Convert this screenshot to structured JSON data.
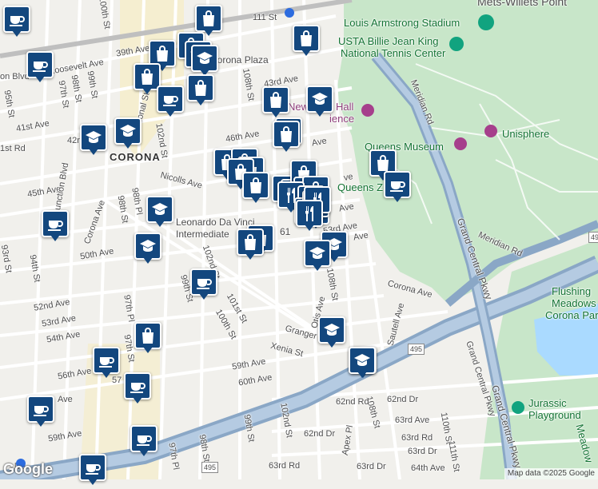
{
  "map": {
    "water_color": "#aadaff",
    "park_color": "#c8e6c9",
    "highway_color": "#8aa7c6",
    "marker_color": "#13477e",
    "attribution": "Map data ©2025 Google",
    "brand": "Google"
  },
  "labels": {
    "mets_willets": "Mets-Willets Point",
    "louis_armstrong": "Louis Armstrong Stadium",
    "usta_1": "USTA Billie Jean King",
    "usta_2": "National Tennis Center",
    "queens_museum": "Queens Museum",
    "unisphere": "Unisphere",
    "queens_zoo": "Queens Z",
    "hall_science_a": "New",
    "hall_science_b": "Hall",
    "hall_science_c": "ience",
    "flushing_1": "Flushing",
    "flushing_2": "Meadows",
    "flushing_3": "Corona Park",
    "jurassic_1": "Jurassic",
    "jurassic_2": "Playground",
    "meadow": "Meadow",
    "corona": "CORONA",
    "corona_plaza": "Corona Plaza",
    "leonardo_1": "Leonardo Da Vinci",
    "leonardo_2": "Intermediate",
    "num_61": "61",
    "st111": "111 St",
    "roosevelt": "Roosevelt Ave",
    "st39": "39th Ave",
    "st100": "100th St",
    "on_blvd": "on Blvd",
    "st97a": "97th St",
    "st98a": "98th St",
    "st99a": "99th St",
    "st95": "95th St",
    "ave41": "41st Ave",
    "ave41b": "1st Rd",
    "ave42": "42n",
    "national_st": "National St",
    "st102a": "102nd St",
    "st108a": "108th St",
    "ave43": "43rd Ave",
    "ave46": "46th Ave",
    "ave45": "45th Ave",
    "nicolls": "Nicolls Ave",
    "junction": "Junction Blvd",
    "corona_ave": "Corona Ave",
    "st98b": "98th St",
    "st98pl": "98th Pl",
    "st94": "94th St",
    "st93": "93rd St",
    "ave50": "50th Ave",
    "st102b": "102nd St",
    "st99b": "99th St",
    "st101": "101st St",
    "st100b": "100th St",
    "st97pl": "97th Pl",
    "ave52": "52nd Ave",
    "ave53": "53rd Ave",
    "ave54": "54th Ave",
    "st97b": "97th St",
    "ave56": "56th Ave",
    "ave57": "57",
    "ave_w": "Ave",
    "ave59": "59th Ave",
    "granger": "Granger St",
    "xenia": "Xenia St",
    "ave59b": "59th Ave",
    "ave60": "60th Ave",
    "otis": "Otis Ave",
    "st108b": "108th St",
    "sautell": "Sautell Ave",
    "corona_ave2": "Corona Ave",
    "ave53b": "53rd Ave",
    "ave_e": "Ave",
    "ave_51": "Ave",
    "ave_49": "Ave",
    "ave_47": "ve",
    "grand_central": "Grand Central Pkwy",
    "grand_central2": "Grand Central Pkwy",
    "grand_central3": "Grand Central Pkwy",
    "meridian_rd": "Meridian Rd",
    "meridian_rd2": "Meridian Rd",
    "shield_495a": "495",
    "shield_495b": "495",
    "shield_495c": "495",
    "st108c": "108th St",
    "rd62": "62nd Rd",
    "dr62": "62nd Dr",
    "dr62b": "62nd Dr",
    "ave63": "63rd Ave",
    "rd63": "63rd Rd",
    "dr63": "63rd Dr",
    "dr63b": "63rd Dr",
    "ave64": "64th Ave",
    "rd63b": "63rd Rd",
    "st102c": "102nd St",
    "st99c": "99th St",
    "st98c": "98th St",
    "st97pl2": "97th Pl",
    "st110": "110th St",
    "st111b": "111th St",
    "apex": "Apex Pl",
    "ave59w": "59th Ave",
    "blvd_w": "lvd"
  },
  "markers": [
    {
      "type": "coffee",
      "icon": "coffee-cup-icon"
    },
    {
      "type": "shopping",
      "icon": "shopping-bag-icon"
    },
    {
      "type": "shopping",
      "icon": "shopping-bag-icon"
    },
    {
      "type": "shopping",
      "icon": "shopping-bag-icon"
    },
    {
      "type": "shopping",
      "icon": "shopping-bag-icon"
    },
    {
      "type": "school",
      "icon": "graduation-cap-icon"
    },
    {
      "type": "school",
      "icon": "graduation-cap-icon"
    },
    {
      "type": "coffee",
      "icon": "coffee-cup-icon"
    },
    {
      "type": "shopping",
      "icon": "shopping-bag-icon"
    },
    {
      "type": "shopping",
      "icon": "shopping-bag-icon"
    },
    {
      "type": "shopping",
      "icon": "shopping-bag-icon"
    },
    {
      "type": "coffee",
      "icon": "coffee-cup-icon"
    },
    {
      "type": "school",
      "icon": "graduation-cap-icon"
    },
    {
      "type": "school",
      "icon": "graduation-cap-icon"
    },
    {
      "type": "shopping",
      "icon": "shopping-bag-icon"
    },
    {
      "type": "school",
      "icon": "graduation-cap-icon"
    },
    {
      "type": "shopping",
      "icon": "shopping-bag-icon"
    },
    {
      "type": "shopping",
      "icon": "shopping-bag-icon"
    },
    {
      "type": "shopping",
      "icon": "shopping-bag-icon"
    },
    {
      "type": "shopping",
      "icon": "shopping-bag-icon"
    },
    {
      "type": "shopping",
      "icon": "shopping-bag-icon"
    },
    {
      "type": "shopping",
      "icon": "shopping-bag-icon"
    },
    {
      "type": "shopping",
      "icon": "shopping-bag-icon"
    },
    {
      "type": "shopping",
      "icon": "shopping-bag-icon"
    },
    {
      "type": "shopping",
      "icon": "shopping-bag-icon"
    },
    {
      "type": "shopping",
      "icon": "shopping-bag-icon"
    },
    {
      "type": "restaurant",
      "icon": "fork-knife-icon"
    },
    {
      "type": "restaurant",
      "icon": "fork-knife-icon"
    },
    {
      "type": "restaurant",
      "icon": "fork-knife-icon"
    },
    {
      "type": "restaurant",
      "icon": "fork-knife-icon"
    },
    {
      "type": "shopping",
      "icon": "shopping-bag-icon"
    },
    {
      "type": "shopping",
      "icon": "shopping-bag-icon"
    },
    {
      "type": "school",
      "icon": "graduation-cap-icon"
    },
    {
      "type": "coffee",
      "icon": "coffee-cup-icon"
    },
    {
      "type": "school",
      "icon": "graduation-cap-icon"
    },
    {
      "type": "coffee",
      "icon": "coffee-cup-icon"
    },
    {
      "type": "school",
      "icon": "graduation-cap-icon"
    },
    {
      "type": "school",
      "icon": "graduation-cap-icon"
    },
    {
      "type": "shopping",
      "icon": "shopping-bag-icon"
    },
    {
      "type": "coffee",
      "icon": "coffee-cup-icon"
    },
    {
      "type": "coffee",
      "icon": "coffee-cup-icon"
    },
    {
      "type": "coffee",
      "icon": "coffee-cup-icon"
    },
    {
      "type": "coffee",
      "icon": "coffee-cup-icon"
    },
    {
      "type": "coffee",
      "icon": "coffee-cup-icon"
    },
    {
      "type": "shopping",
      "icon": "shopping-bag-icon"
    },
    {
      "type": "school",
      "icon": "graduation-cap-icon"
    },
    {
      "type": "shopping",
      "icon": "shopping-bag-icon"
    },
    {
      "type": "school",
      "icon": "graduation-cap-icon"
    },
    {
      "type": "school",
      "icon": "graduation-cap-icon"
    },
    {
      "type": "coffee",
      "icon": "coffee-cup-icon"
    },
    {
      "type": "shopping",
      "icon": "shopping-bag-icon"
    },
    {
      "type": "restaurant",
      "icon": "fork-knife-icon"
    },
    {
      "type": "restaurant",
      "icon": "fork-knife-icon"
    }
  ]
}
